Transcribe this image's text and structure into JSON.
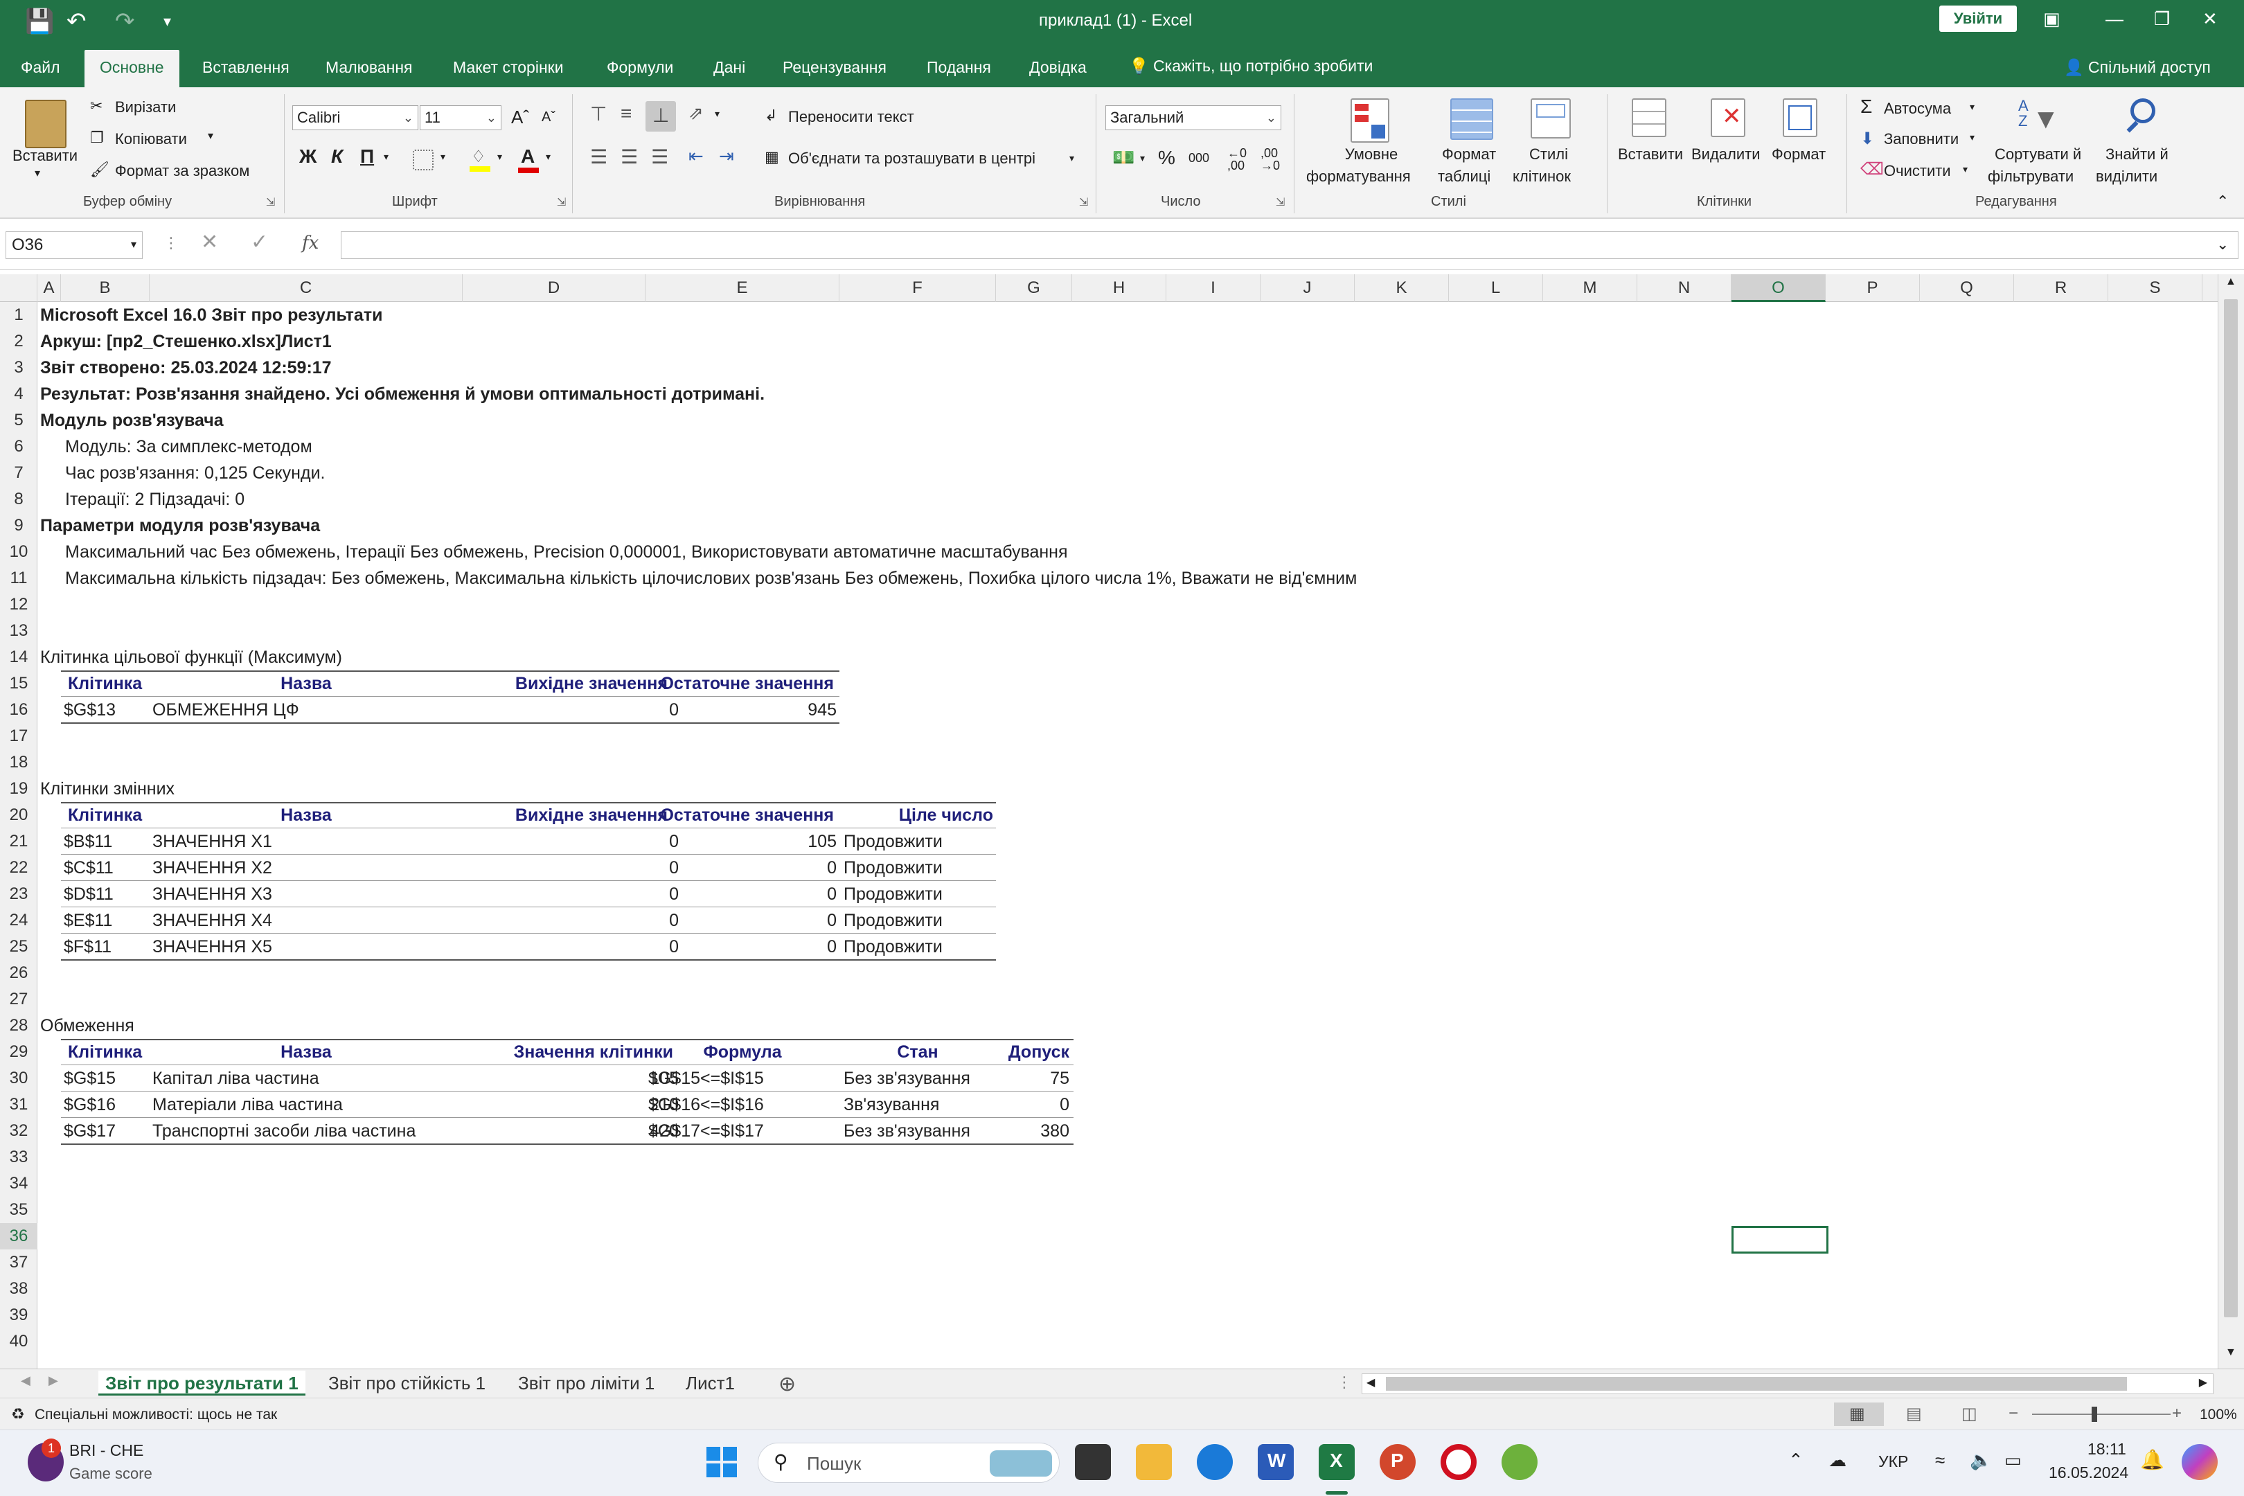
{
  "titlebar": {
    "doc_title": "приклад1 (1)  -  Excel",
    "signin": "Увійти"
  },
  "tabs": [
    "Файл",
    "Основне",
    "Вставлення",
    "Малювання",
    "Макет сторінки",
    "Формули",
    "Дані",
    "Рецензування",
    "Подання",
    "Довідка"
  ],
  "tellme": "Скажіть, що потрібно зробити",
  "share": "Спільний доступ",
  "ribbon": {
    "paste": "Вставити",
    "cut": "Вирізати",
    "copy": "Копіювати",
    "format_painter": "Формат за зразком",
    "clipboard": "Буфер обміну",
    "font_name": "Calibri",
    "font_size": "11",
    "font": "Шрифт",
    "bold": "Ж",
    "italic": "К",
    "underline": "П",
    "wrap": "Переносити текст",
    "merge": "Об'єднати та розташувати в центрі",
    "alignment": "Вирівнювання",
    "number_format": "Загальний",
    "number": "Число",
    "percent": "%",
    "thousands": "000",
    "cond_format_1": "Умовне",
    "cond_format_2": "форматування",
    "format_table_1": "Формат",
    "format_table_2": "таблиці",
    "cell_styles_1": "Стилі",
    "cell_styles_2": "клітинок",
    "styles": "Стилі",
    "insert": "Вставити",
    "delete": "Видалити",
    "format": "Формат",
    "cells": "Клітинки",
    "autosum": "Автосума",
    "fill": "Заповнити",
    "clear": "Очистити",
    "sort_1": "Сортувати й",
    "sort_2": "фільтрувати",
    "find_1": "Знайти й",
    "find_2": "виділити",
    "editing": "Редагування"
  },
  "namebox": "O36",
  "fx_label": "fx",
  "columns": [
    "A",
    "B",
    "C",
    "D",
    "E",
    "F",
    "G",
    "H",
    "I",
    "J",
    "K",
    "L",
    "M",
    "N",
    "O",
    "P",
    "Q",
    "R",
    "S"
  ],
  "selected_column": "O",
  "rows": [
    "1",
    "2",
    "3",
    "4",
    "5",
    "6",
    "7",
    "8",
    "9",
    "10",
    "11",
    "12",
    "13",
    "14",
    "15",
    "16",
    "17",
    "18",
    "19",
    "20",
    "21",
    "22",
    "23",
    "24",
    "25",
    "26",
    "27",
    "28",
    "29",
    "30",
    "31",
    "32",
    "33",
    "34",
    "35",
    "36",
    "37",
    "38",
    "39",
    "40"
  ],
  "selected_row": "36",
  "report": {
    "r1": "Microsoft Excel 16.0 Звіт про результати",
    "r2": "Аркуш: [пр2_Стешенко.xlsx]Лист1",
    "r3": "Звіт створено: 25.03.2024 12:59:17",
    "r4": "Результат: Розв'язання знайдено. Усі обмеження й умови оптимальності дотримані.",
    "r5": "Модуль розв'язувача",
    "r6": "Модуль: За симплекс-методом",
    "r7": "Час розв'язання: 0,125 Секунди.",
    "r8": "Ітерації: 2 Підзадачі: 0",
    "r9": "Параметри модуля розв'язувача",
    "r10": "Максимальний час Без обмежень,  Ітерації Без обмежень, Precision 0,000001, Використовувати автоматичне масштабування",
    "r11": "Максимальна кількість підзадач: Без обмежень, Максимальна кількість цілочислових розв'язань Без обмежень, Похибка цілого числа 1%, Вважати не від'ємним",
    "r14": "Клітинка цільової функції (Максимум)",
    "r19": "Клітинки змінних",
    "r28": "Обмеження"
  },
  "objective": {
    "headers": [
      "Клітинка",
      "Назва",
      "Вихідне значення",
      "Остаточне значення"
    ],
    "rows": [
      [
        "$G$13",
        "ОБМЕЖЕННЯ ЦФ",
        "0",
        "945"
      ]
    ]
  },
  "variables": {
    "headers": [
      "Клітинка",
      "Назва",
      "Вихідне значення",
      "Остаточне значення",
      "Ціле число"
    ],
    "rows": [
      [
        "$B$11",
        "ЗНАЧЕННЯ X1",
        "0",
        "105",
        "Продовжити"
      ],
      [
        "$C$11",
        "ЗНАЧЕННЯ X2",
        "0",
        "0",
        "Продовжити"
      ],
      [
        "$D$11",
        "ЗНАЧЕННЯ X3",
        "0",
        "0",
        "Продовжити"
      ],
      [
        "$E$11",
        "ЗНАЧЕННЯ X4",
        "0",
        "0",
        "Продовжити"
      ],
      [
        "$F$11",
        "ЗНАЧЕННЯ X5",
        "0",
        "0",
        "Продовжити"
      ]
    ]
  },
  "constraints": {
    "headers": [
      "Клітинка",
      "Назва",
      "Значення клітинки",
      "Формула",
      "Стан",
      "Допуск"
    ],
    "rows": [
      [
        "$G$15",
        "Капітал ліва частина",
        "105",
        "$G$15<=$I$15",
        "Без зв'язування",
        "75"
      ],
      [
        "$G$16",
        "Матеріали ліва частина",
        "210",
        "$G$16<=$I$16",
        "Зв'язування",
        "0"
      ],
      [
        "$G$17",
        "Транспортні засоби  ліва частина",
        "420",
        "$G$17<=$I$17",
        "Без зв'язування",
        "380"
      ]
    ]
  },
  "sheet_tabs": [
    "Звіт про результати 1",
    "Звіт про стійкість 1",
    "Звіт про ліміти 1",
    "Лист1"
  ],
  "status": {
    "accessibility": "Спеціальні можливості: щось не так",
    "zoom": "100%"
  },
  "taskbar": {
    "notif_title": "BRI - CHE",
    "notif_sub": "Game score",
    "badge": "1",
    "search": "Пошук",
    "lang": "УКР",
    "time": "18:11",
    "date": "16.05.2024"
  },
  "colors": {
    "excel_green": "#217346",
    "header_text": "#1f1f7a"
  }
}
